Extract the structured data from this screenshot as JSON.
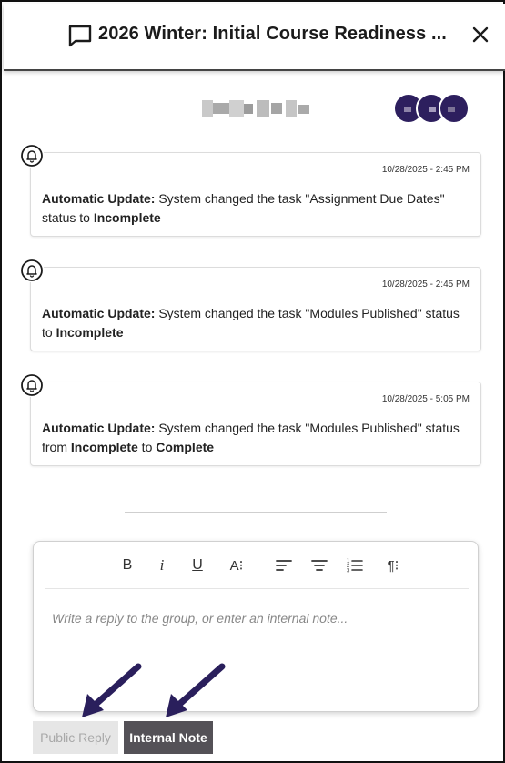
{
  "header": {
    "title": "2026 Winter: Initial Course Readiness ...",
    "icon": "chat-bubble-icon",
    "close_icon": "close-icon"
  },
  "activities": [
    {
      "timestamp": "10/28/2025 - 2:45 PM",
      "prefix": "Automatic Update:",
      "text_a": " System changed the task \"Assignment Due Dates\" status to ",
      "bold_a": "Incomplete"
    },
    {
      "timestamp": "10/28/2025 - 2:45 PM",
      "prefix": "Automatic Update:",
      "text_a": " System changed the task \"Modules Published\" status to ",
      "bold_a": "Incomplete"
    },
    {
      "timestamp": "10/28/2025 - 5:05 PM",
      "prefix": "Automatic Update:",
      "text_a": " System changed the task \"Modules Published\" status from ",
      "bold_a": "Incomplete",
      "text_b": " to ",
      "bold_b": "Complete"
    }
  ],
  "toolbar": {
    "bold": "B",
    "italic": "i",
    "underline": "U",
    "font_size": "A⁝",
    "paragraph": "¶⁝"
  },
  "editor": {
    "placeholder": "Write a reply to the group, or enter an internal note..."
  },
  "buttons": {
    "public_reply": "Public Reply",
    "internal_note": "Internal Note"
  },
  "colors": {
    "avatar": "#2d1f5e",
    "internal_note_bg": "#545157",
    "arrow": "#2a1f5c"
  }
}
